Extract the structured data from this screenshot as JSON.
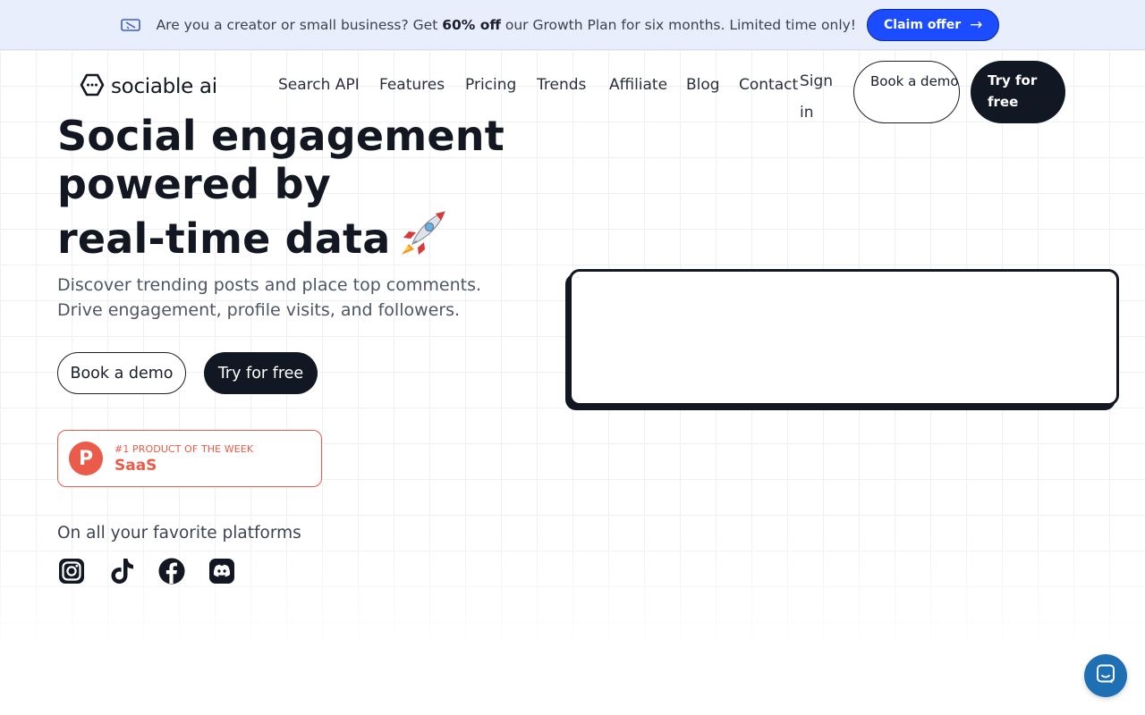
{
  "banner": {
    "text_before": "Are you a creator or small business? Get ",
    "highlight": "60% off",
    "text_after": " our Growth Plan for six months. Limited time only!",
    "cta_label": "Claim offer",
    "cta_arrow": "→",
    "cta_color": "#1b4cff",
    "icon": "ticket-icon"
  },
  "nav": {
    "logo_text": "sociable ai",
    "links": [
      "Search API",
      "Features",
      "Pricing",
      "Trends",
      "Affiliate",
      "Blog",
      "Contact"
    ],
    "signin_label": "Sign in",
    "demo_label": "Book a demo",
    "try_label": "Try for free"
  },
  "hero": {
    "title_line1": "Social engagement",
    "title_line2": "powered by",
    "title_line3": "real-time data",
    "title_emoji": "rocket-icon",
    "subtitle_line1": "Discover trending posts and place top comments.",
    "subtitle_line2": "Drive engagement, profile visits, and followers.",
    "demo_button": "Book a demo",
    "try_button": "Try for free"
  },
  "product_hunt": {
    "letter": "P",
    "rank_text": "#1 PRODUCT OF THE WEEK",
    "category": "SaaS",
    "color": "#ea5b4a"
  },
  "platforms": {
    "label": "On all your favorite platforms",
    "icons": [
      "instagram-icon",
      "tiktok-icon",
      "facebook-icon",
      "discord-icon"
    ]
  },
  "colors": {
    "dark": "#111723",
    "chat": "#1f6fb4"
  }
}
